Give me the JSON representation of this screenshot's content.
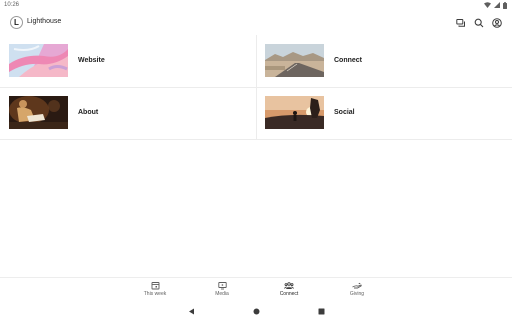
{
  "status_bar": {
    "time": "10:26",
    "icons": [
      "wifi-icon",
      "cellular-icon",
      "battery-icon"
    ]
  },
  "app_bar": {
    "logo_letter": "L",
    "title": "Lighthouse",
    "actions": [
      "messages-icon",
      "search-icon",
      "account-icon"
    ]
  },
  "tiles": [
    {
      "label": "Website",
      "thumbnail": "pink-abstract-image"
    },
    {
      "label": "Connect",
      "thumbnail": "desert-road-image"
    },
    {
      "label": "About",
      "thumbnail": "person-reading-image"
    },
    {
      "label": "Social",
      "thumbnail": "sunset-silhouette-image"
    }
  ],
  "bottom_nav": {
    "items": [
      {
        "label": "This week",
        "icon": "calendar-icon",
        "selected": false
      },
      {
        "label": "Media",
        "icon": "media-icon",
        "selected": false
      },
      {
        "label": "Connect",
        "icon": "people-icon",
        "selected": true
      },
      {
        "label": "Giving",
        "icon": "giving-icon",
        "selected": false
      }
    ]
  },
  "system_nav": [
    "back-icon",
    "home-icon",
    "recents-icon"
  ],
  "colors": {
    "background": "#ffffff",
    "text": "#1f1f1f",
    "secondary_text": "#5f5f5f",
    "divider": "#ececec"
  }
}
